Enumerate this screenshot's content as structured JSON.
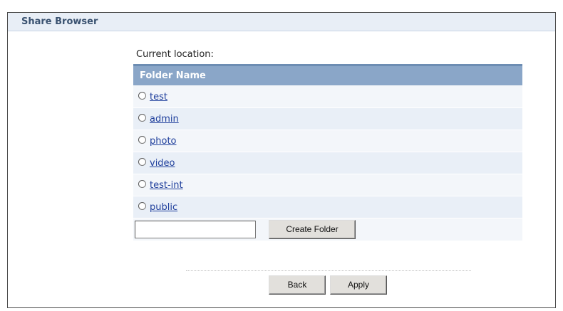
{
  "window": {
    "title": "Share Browser"
  },
  "location": {
    "label": "Current location:"
  },
  "table": {
    "header": "Folder Name",
    "folders": [
      {
        "name": "test"
      },
      {
        "name": "admin"
      },
      {
        "name": "photo"
      },
      {
        "name": "video"
      },
      {
        "name": "test-int"
      },
      {
        "name": "public"
      }
    ]
  },
  "create": {
    "input_value": "",
    "button_label": "Create Folder"
  },
  "footer": {
    "back_label": "Back",
    "apply_label": "Apply"
  },
  "colors": {
    "header_bg": "#8aa6c8",
    "title_bar_bg": "#e8eef6",
    "link": "#1f3f9c",
    "row_odd": "#f3f6fa",
    "row_even": "#e9eff7"
  }
}
